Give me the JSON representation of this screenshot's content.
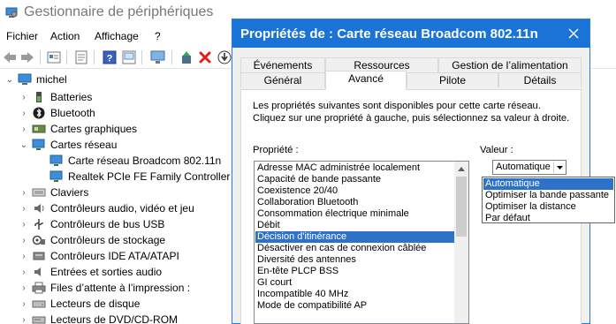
{
  "device_manager": {
    "title": "Gestionnaire de périphériques",
    "menu": [
      "Fichier",
      "Action",
      "Affichage",
      "?"
    ],
    "toolbar_icons": [
      "back-arrow-icon",
      "forward-arrow-icon",
      "properties-icon",
      "update-driver-icon",
      "help-icon",
      "scan-hardware-icon",
      "add-driver-icon",
      "uninstall-icon",
      "download-icon"
    ],
    "tree": {
      "root": "michel",
      "nodes": [
        {
          "label": "Batteries",
          "icon": "battery-icon",
          "expanded": false
        },
        {
          "label": "Bluetooth",
          "icon": "bluetooth-icon",
          "expanded": false
        },
        {
          "label": "Cartes graphiques",
          "icon": "display-adapter-icon",
          "expanded": false
        },
        {
          "label": "Cartes réseau",
          "icon": "network-adapter-icon",
          "expanded": true
        },
        {
          "label": "Carte réseau Broadcom 802.11n",
          "icon": "network-adapter-icon",
          "child": true
        },
        {
          "label": "Realtek PCIe FE Family Controller",
          "icon": "network-adapter-icon",
          "child": true
        },
        {
          "label": "Claviers",
          "icon": "keyboard-icon",
          "expanded": false
        },
        {
          "label": "Contrôleurs audio, vidéo et jeu",
          "icon": "speaker-icon",
          "expanded": false
        },
        {
          "label": "Contrôleurs de bus USB",
          "icon": "usb-icon",
          "expanded": false
        },
        {
          "label": "Contrôleurs de stockage",
          "icon": "storage-controller-icon",
          "expanded": false
        },
        {
          "label": "Contrôleurs IDE ATA/ATAPI",
          "icon": "ide-controller-icon",
          "expanded": false
        },
        {
          "label": "Entrées et sorties audio",
          "icon": "audio-io-icon",
          "expanded": false
        },
        {
          "label": "Files d’attente à l’impression :",
          "icon": "printer-icon",
          "expanded": false
        },
        {
          "label": "Lecteurs de disque",
          "icon": "disk-drive-icon",
          "expanded": false
        },
        {
          "label": "Lecteurs de DVD/CD-ROM",
          "icon": "dvd-drive-icon",
          "expanded": false
        }
      ]
    }
  },
  "dialog": {
    "title": "Propriétés de : Carte réseau Broadcom 802.11n",
    "tabs_row1": [
      "Événements",
      "Ressources",
      "Gestion de l’alimentation"
    ],
    "tabs_row2": [
      "Général",
      "Avancé",
      "Pilote",
      "Détails"
    ],
    "active_tab": "Avancé",
    "description": "Les propriétés suivantes sont disponibles pour cette carte réseau. Cliquez sur une propriété à gauche, puis sélectionnez sa valeur à droite.",
    "property_label": "Propriété :",
    "value_label": "Valeur :",
    "properties": [
      "Adresse MAC administrée localement",
      "Capacité de bande passante",
      "Coexistence 20/40",
      "Collaboration Bluetooth",
      "Consommation électrique minimale",
      "Débit",
      "Décision d'itinérance",
      "Désactiver en cas de connexion câblée",
      "Diversité des antennes",
      "En-tête PLCP BSS",
      "GI court",
      "Incompatible 40 MHz",
      "Mode de compatibilité AP"
    ],
    "selected_property": "Décision d'itinérance",
    "value_selected": "Automatique",
    "value_options": [
      "Automatique",
      "Optimiser la bande passante",
      "Optimiser la distance",
      "Par défaut"
    ],
    "highlighted_option": "Automatique"
  },
  "colors": {
    "dialog_title_bg": "#1a73d6",
    "selection_bg": "#2d72c9",
    "window_bg": "#f0f0f0"
  }
}
